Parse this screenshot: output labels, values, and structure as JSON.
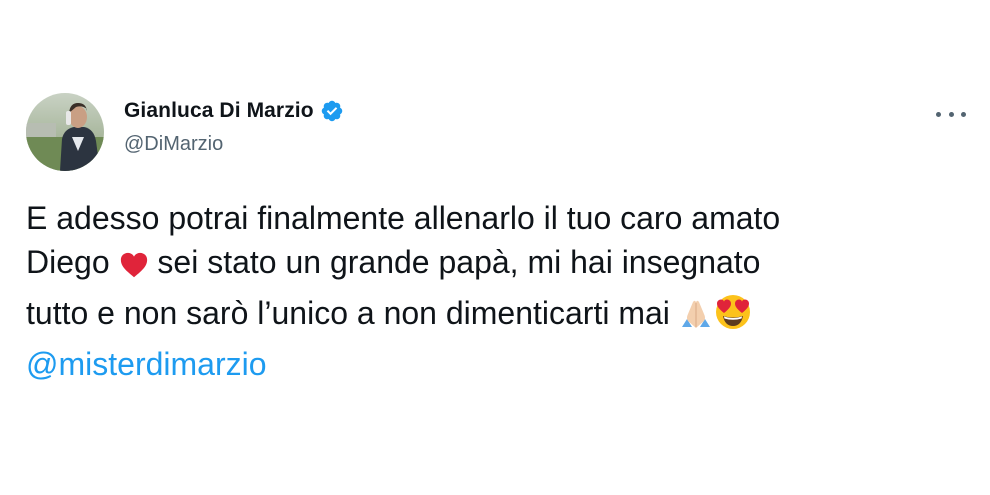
{
  "tweet": {
    "author": {
      "name": "Gianluca Di Marzio",
      "handle": "@DiMarzio",
      "verified": true
    },
    "text": {
      "line1": "E adesso potrai finalmente allenarlo il tuo caro amato",
      "line2_a": "Diego",
      "line2_b": " sei stato un grande papà, mi hai insegnato",
      "line3": "tutto e non sarò l’unico a non dimenticarti mai",
      "mention": "@misterdimarzio"
    },
    "emojis": [
      "red-heart",
      "folded-hands",
      "heart-eyes-face"
    ]
  },
  "colors": {
    "text": "#0f1419",
    "secondary": "#536471",
    "link": "#1d9bf0",
    "verified": "#1d9bf0"
  }
}
